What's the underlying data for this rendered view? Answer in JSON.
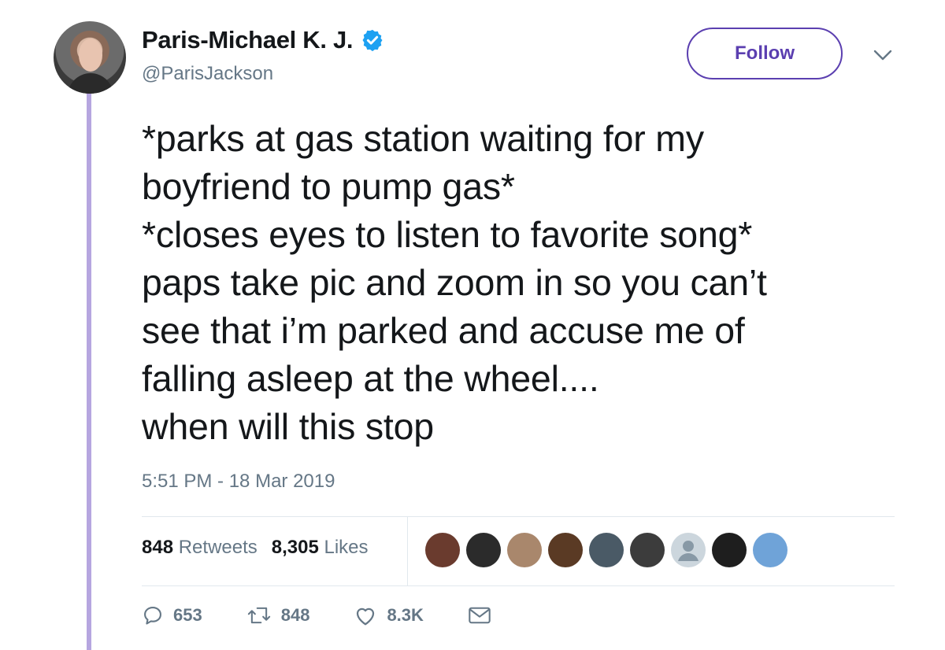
{
  "user": {
    "display_name": "Paris-Michael K. J.",
    "handle": "@ParisJackson",
    "verified": true,
    "verified_color": "#1da1f2"
  },
  "follow_button": {
    "label": "Follow",
    "color": "#5b3fb0"
  },
  "tweet": {
    "text": "*parks at gas station waiting for my\nboyfriend to pump gas*\n*closes eyes to listen to favorite song*\npaps take pic and zoom in so you can’t\nsee that i’m parked and accuse me of\nfalling asleep at the wheel....\nwhen will this stop",
    "timestamp": "5:51 PM - 18 Mar 2019"
  },
  "stats": {
    "retweets_count": "848",
    "retweets_label": "Retweets",
    "likes_count": "8,305",
    "likes_label": "Likes"
  },
  "likers": [
    {
      "icon": "liker-avatar-1",
      "color": "#6a3b2e"
    },
    {
      "icon": "liker-avatar-2",
      "color": "#2b2b2b"
    },
    {
      "icon": "liker-avatar-3",
      "color": "#a9876c"
    },
    {
      "icon": "liker-avatar-4",
      "color": "#5a3a24"
    },
    {
      "icon": "liker-avatar-5",
      "color": "#4a5a66"
    },
    {
      "icon": "liker-avatar-6",
      "color": "#3c3c3c"
    },
    {
      "icon": "liker-avatar-default",
      "color": "#ccd6dd"
    },
    {
      "icon": "liker-avatar-8",
      "color": "#1e1e1e"
    },
    {
      "icon": "liker-avatar-9",
      "color": "#6fa3d8"
    }
  ],
  "actions": {
    "replies": "653",
    "retweets": "848",
    "likes": "8.3K"
  },
  "colors": {
    "thread_line": "#b6a6e0",
    "secondary_text": "#657786",
    "divider": "#e1e8ed"
  }
}
